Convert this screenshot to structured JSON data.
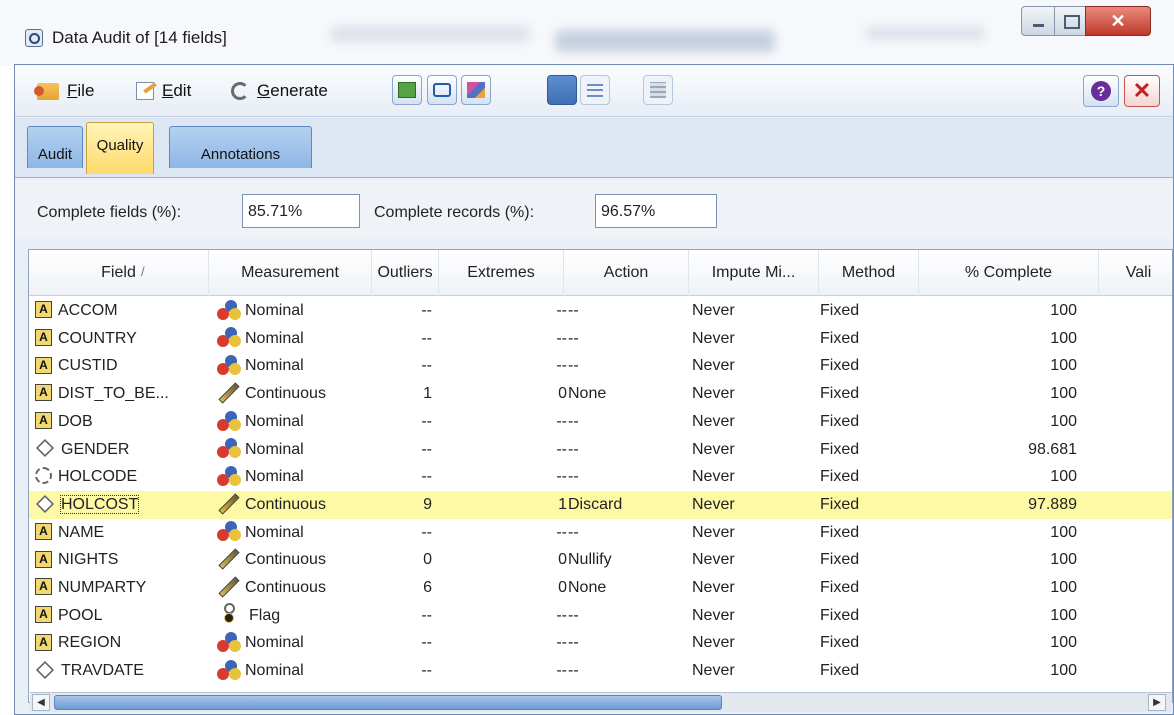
{
  "window": {
    "title": "Data Audit of [14 fields]",
    "close_glyph": "✕"
  },
  "menu": {
    "file": "File",
    "edit": "Edit",
    "generate": "Generate"
  },
  "toolbar": {
    "help_glyph": "?",
    "close_glyph": "✕"
  },
  "tabs": [
    {
      "label": "Audit"
    },
    {
      "label": "Quality"
    },
    {
      "label": "Annotations"
    }
  ],
  "summary": {
    "complete_fields_label": "Complete fields (%):",
    "complete_fields_value": "85.71%",
    "complete_records_label": "Complete records (%):",
    "complete_records_value": "96.57%"
  },
  "table": {
    "columns": [
      "Field",
      "Measurement",
      "Outliers",
      "Extremes",
      "Action",
      "Impute Mi...",
      "Method",
      "% Complete",
      "Vali"
    ],
    "sort_indicator": "/",
    "rows": [
      {
        "type_icon": "string-a-icon",
        "field": "ACCOM",
        "measurement": "Nominal",
        "m_icon": "nominal-icon",
        "outliers": "--",
        "extremes": "--",
        "action": "--",
        "impute": "Never",
        "method": "Fixed",
        "complete": "100"
      },
      {
        "type_icon": "string-a-icon",
        "field": "COUNTRY",
        "measurement": "Nominal",
        "m_icon": "nominal-icon",
        "outliers": "--",
        "extremes": "--",
        "action": "--",
        "impute": "Never",
        "method": "Fixed",
        "complete": "100"
      },
      {
        "type_icon": "string-a-icon",
        "field": "CUSTID",
        "measurement": "Nominal",
        "m_icon": "nominal-icon",
        "outliers": "--",
        "extremes": "--",
        "action": "--",
        "impute": "Never",
        "method": "Fixed",
        "complete": "100"
      },
      {
        "type_icon": "string-a-icon",
        "field": "DIST_TO_BE...",
        "measurement": "Continuous",
        "m_icon": "continuous-icon",
        "outliers": "1",
        "extremes": "0",
        "action": "None",
        "impute": "Never",
        "method": "Fixed",
        "complete": "100"
      },
      {
        "type_icon": "string-a-icon",
        "field": "DOB",
        "measurement": "Nominal",
        "m_icon": "nominal-icon",
        "outliers": "--",
        "extremes": "--",
        "action": "--",
        "impute": "Never",
        "method": "Fixed",
        "complete": "100"
      },
      {
        "type_icon": "date-diamond-icon",
        "field": "GENDER",
        "measurement": "Nominal",
        "m_icon": "nominal-icon",
        "outliers": "--",
        "extremes": "--",
        "action": "--",
        "impute": "Never",
        "method": "Fixed",
        "complete": "98.681"
      },
      {
        "type_icon": "integer-circle-icon",
        "field": "HOLCODE",
        "measurement": "Nominal",
        "m_icon": "nominal-icon",
        "outliers": "--",
        "extremes": "--",
        "action": "--",
        "impute": "Never",
        "method": "Fixed",
        "complete": "100"
      },
      {
        "type_icon": "date-diamond-icon",
        "field": "HOLCOST",
        "measurement": "Continuous",
        "m_icon": "continuous-icon",
        "outliers": "9",
        "extremes": "1",
        "action": "Discard",
        "impute": "Never",
        "method": "Fixed",
        "complete": "97.889",
        "highlight": true
      },
      {
        "type_icon": "string-a-icon",
        "field": "NAME",
        "measurement": "Nominal",
        "m_icon": "nominal-icon",
        "outliers": "--",
        "extremes": "--",
        "action": "--",
        "impute": "Never",
        "method": "Fixed",
        "complete": "100"
      },
      {
        "type_icon": "string-a-icon",
        "field": "NIGHTS",
        "measurement": "Continuous",
        "m_icon": "continuous-icon",
        "outliers": "0",
        "extremes": "0",
        "action": "Nullify",
        "impute": "Never",
        "method": "Fixed",
        "complete": "100"
      },
      {
        "type_icon": "string-a-icon",
        "field": "NUMPARTY",
        "measurement": "Continuous",
        "m_icon": "continuous-icon",
        "outliers": "6",
        "extremes": "0",
        "action": "None",
        "impute": "Never",
        "method": "Fixed",
        "complete": "100"
      },
      {
        "type_icon": "string-a-icon",
        "field": "POOL",
        "measurement": "Flag",
        "m_icon": "flag-icon",
        "outliers": "--",
        "extremes": "--",
        "action": "--",
        "impute": "Never",
        "method": "Fixed",
        "complete": "100"
      },
      {
        "type_icon": "string-a-icon",
        "field": "REGION",
        "measurement": "Nominal",
        "m_icon": "nominal-icon",
        "outliers": "--",
        "extremes": "--",
        "action": "--",
        "impute": "Never",
        "method": "Fixed",
        "complete": "100"
      },
      {
        "type_icon": "date-diamond-icon",
        "field": "TRAVDATE",
        "measurement": "Nominal",
        "m_icon": "nominal-icon",
        "outliers": "--",
        "extremes": "--",
        "action": "--",
        "impute": "Never",
        "method": "Fixed",
        "complete": "100"
      }
    ]
  },
  "scrollbar": {
    "left_glyph": "◀",
    "right_glyph": "▶"
  }
}
